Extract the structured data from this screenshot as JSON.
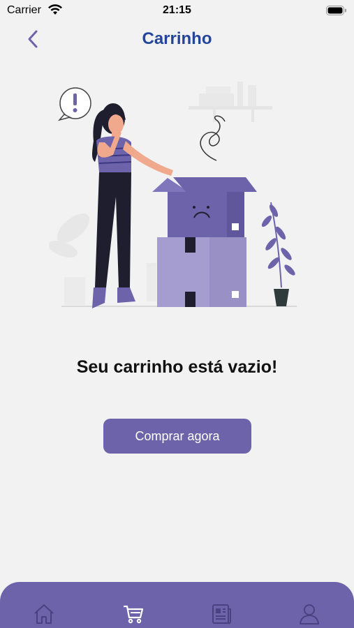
{
  "status_bar": {
    "carrier": "Carrier",
    "time": "21:15",
    "wifi_icon": "wifi-icon",
    "battery_icon": "battery-icon"
  },
  "header": {
    "title": "Carrinho",
    "back_icon": "chevron-left-icon"
  },
  "illustration": {
    "description_icon": "empty-cart-illustration",
    "alert_symbol": "!"
  },
  "empty_state": {
    "message": "Seu carrinho está vazio!",
    "button_label": "Comprar agora"
  },
  "tab_bar": {
    "items": [
      {
        "icon": "home-icon",
        "active": false
      },
      {
        "icon": "cart-icon",
        "active": true
      },
      {
        "icon": "news-icon",
        "active": false
      },
      {
        "icon": "profile-icon",
        "active": false
      }
    ]
  },
  "colors": {
    "background": "#f2f2f2",
    "title": "#23459b",
    "accent": "#6d63aa",
    "back_chevron": "#6d63aa",
    "text": "#111111"
  }
}
